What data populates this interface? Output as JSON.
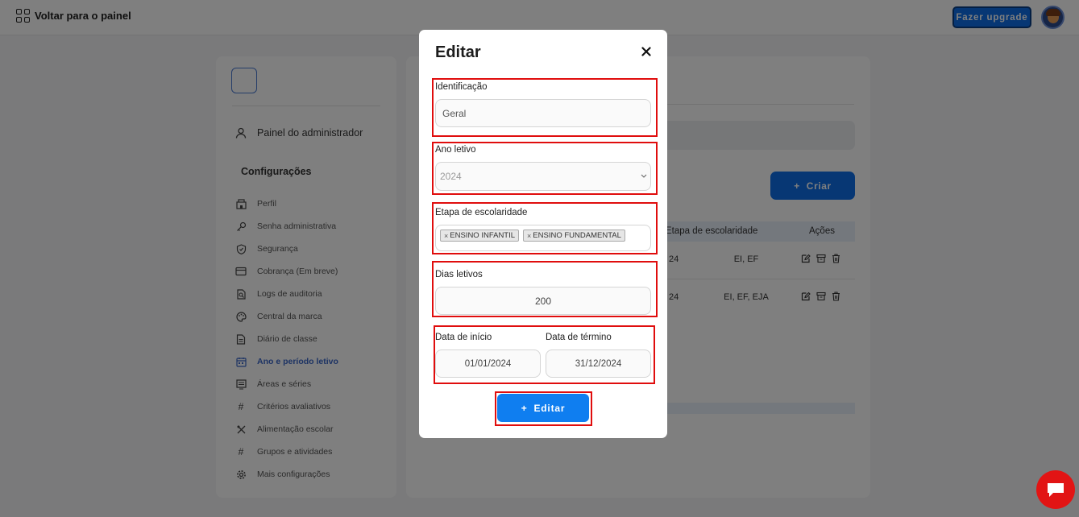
{
  "topbar": {
    "back_label": "Voltar para o painel",
    "upgrade_label": "Fazer upgrade"
  },
  "sidebar": {
    "admin_label": "Painel do administrador",
    "section_title": "Configurações",
    "items": [
      {
        "label": "Perfil",
        "icon": "building-icon"
      },
      {
        "label": "Senha administrativa",
        "icon": "key-icon"
      },
      {
        "label": "Segurança",
        "icon": "shield-icon"
      },
      {
        "label": "Cobrança (Em breve)",
        "icon": "card-icon"
      },
      {
        "label": "Logs de auditoria",
        "icon": "search-doc-icon"
      },
      {
        "label": "Central da marca",
        "icon": "palette-icon"
      },
      {
        "label": "Diário de classe",
        "icon": "document-icon"
      },
      {
        "label": "Ano e período letivo",
        "icon": "calendar-icon",
        "active": true
      },
      {
        "label": "Áreas e séries",
        "icon": "list-icon"
      },
      {
        "label": "Critérios avaliativos",
        "icon": "hash-icon"
      },
      {
        "label": "Alimentação escolar",
        "icon": "utensils-icon"
      },
      {
        "label": "Grupos e atividades",
        "icon": "hash-icon"
      },
      {
        "label": "Mais configurações",
        "icon": "gear-icon"
      }
    ]
  },
  "main": {
    "create_label": "Criar",
    "columns": {
      "etapa": "Etapa de escolaridade",
      "acoes": "Ações"
    },
    "rows": [
      {
        "ano": "24",
        "etapa": "EI, EF"
      },
      {
        "ano": "24",
        "etapa": "EI, EF, EJA"
      }
    ]
  },
  "modal": {
    "title": "Editar",
    "identificacao_label": "Identificação",
    "identificacao_value": "Geral",
    "ano_label": "Ano letivo",
    "ano_value": "2024",
    "etapa_label": "Etapa de escolaridade",
    "etapa_chips": [
      "ENSINO INFANTIL",
      "ENSINO FUNDAMENTAL"
    ],
    "dias_label": "Dias letivos",
    "dias_value": "200",
    "inicio_label": "Data de início",
    "inicio_value": "01/01/2024",
    "termino_label": "Data de término",
    "termino_value": "31/12/2024",
    "submit_label": "Editar"
  },
  "colors": {
    "primary": "#0f7ef0",
    "highlight": "#e00d0d",
    "chat": "#e21414"
  }
}
